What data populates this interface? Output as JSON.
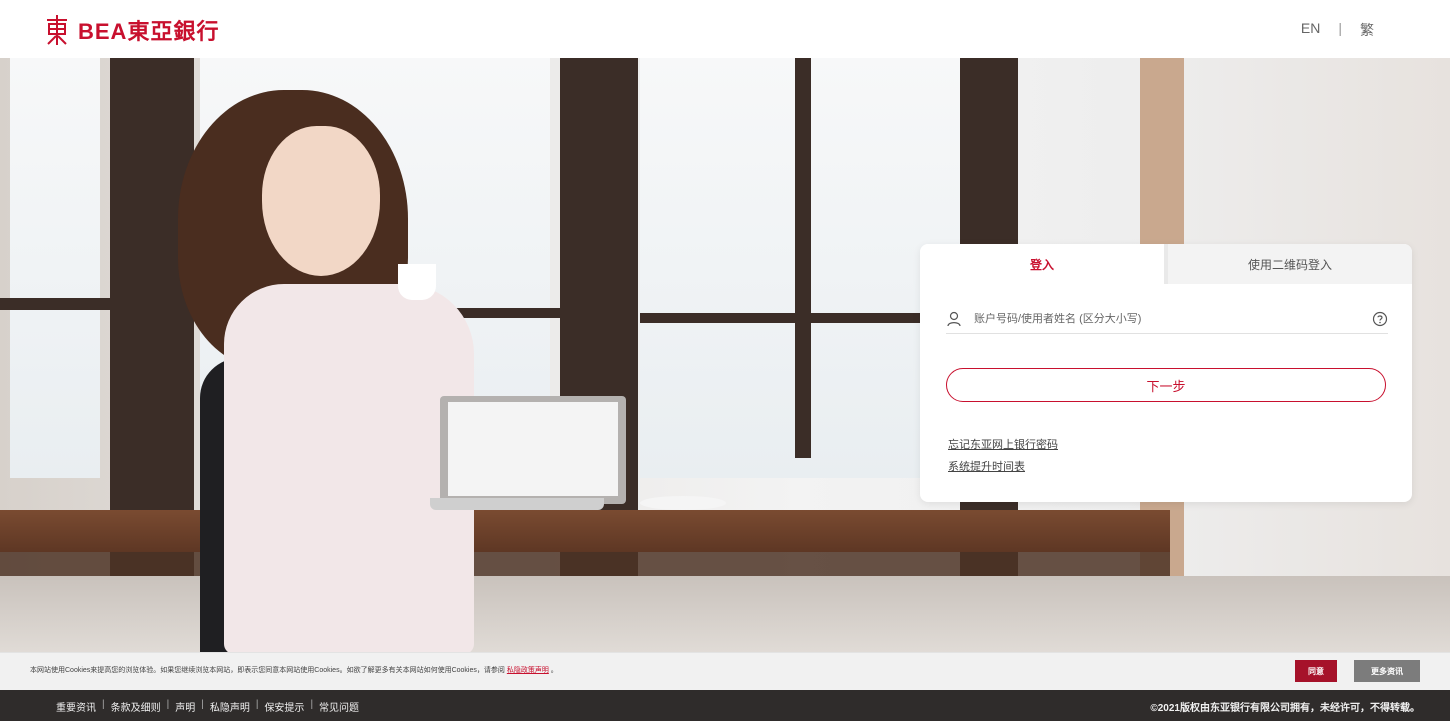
{
  "brand": {
    "name": "BEA東亞銀行",
    "color": "#c8102e"
  },
  "language": {
    "en": "EN",
    "separator": "|",
    "trad": "繁"
  },
  "login": {
    "tabs": [
      {
        "label": "登入",
        "active": true
      },
      {
        "label": "使用二维码登入",
        "active": false
      }
    ],
    "username_placeholder": "账户号码/使用者姓名 (区分大小写)",
    "username_value": "",
    "next_label": "下一步",
    "links": [
      "忘记东亚网上银行密码",
      "系统提升时间表"
    ]
  },
  "cookie_bar": {
    "text": "本网站使用Cookies来提高您的浏览体验。如果您继续浏览本网站，即表示您同意本网站使用Cookies。如欲了解更多有关本网站如何使用Cookies，请参阅",
    "link": "私隐政策声明",
    "tail": "。",
    "agree_label": "同意",
    "more_label": "更多资讯"
  },
  "footer": {
    "links": [
      "重要资讯",
      "条款及细则",
      "声明",
      "私隐声明",
      "保安提示",
      "常见问题"
    ],
    "separator": "|",
    "copyright": "©2021版权由东亚银行有限公司拥有，未经许可，不得转载。"
  },
  "icons": {
    "logo": "bea-logo-icon",
    "user": "user-icon",
    "help": "help-circle-icon"
  }
}
